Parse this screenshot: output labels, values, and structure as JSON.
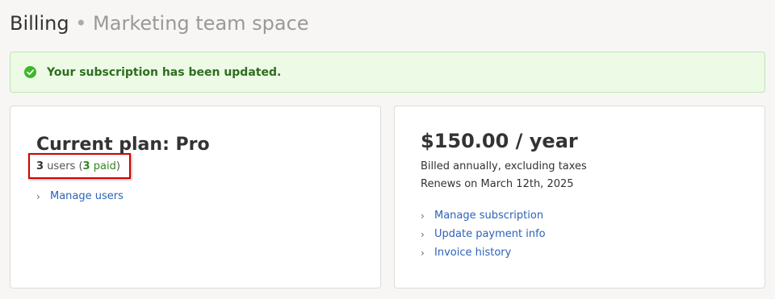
{
  "header": {
    "title": "Billing",
    "separator": "•",
    "space_name": "Marketing team space"
  },
  "alert": {
    "icon": "check-circle-icon",
    "message": "Your subscription has been updated.",
    "color": "#2f6e1f"
  },
  "plan_card": {
    "title": "Current plan: Pro",
    "users_count": "3",
    "users_word": "users",
    "paid_count": "3",
    "paid_word": "paid",
    "manage_users_label": "Manage users"
  },
  "billing_card": {
    "price": "$150.00 / year",
    "billing_note": "Billed annually, excluding taxes",
    "renewal_note": "Renews on March 12th, 2025",
    "links": [
      "Manage subscription",
      "Update payment info",
      "Invoice history"
    ]
  },
  "colors": {
    "link": "#2d63b8",
    "success": "#2f8a1f",
    "highlight_box": "#d40000"
  }
}
